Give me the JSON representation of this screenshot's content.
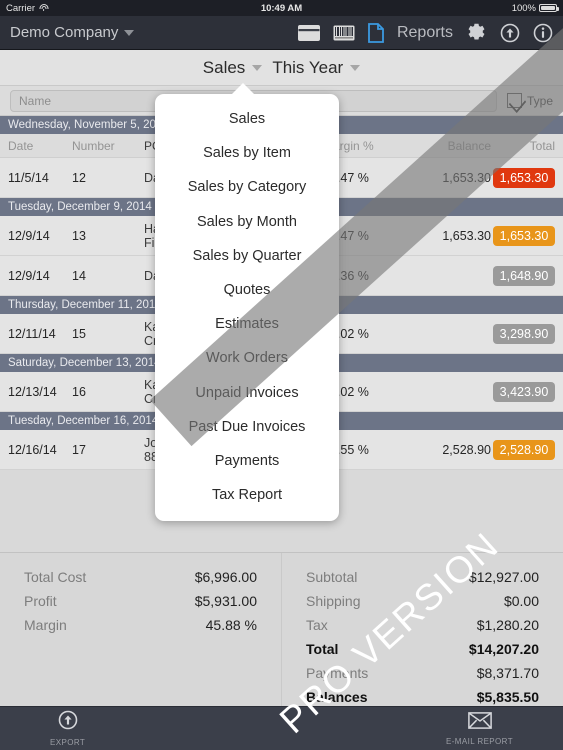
{
  "statusbar": {
    "carrier": "Carrier",
    "time": "10:49 AM",
    "battery": "100%"
  },
  "navbar": {
    "company": "Demo Company",
    "reports_label": "Reports",
    "icons": [
      "credit-card-icon",
      "barcode-icon",
      "document-icon",
      "gear-icon",
      "upload-icon",
      "info-icon"
    ]
  },
  "filterbar": {
    "report_type": "Sales",
    "period": "This Year"
  },
  "search": {
    "value": "",
    "placeholder": "Name",
    "type_label": "Type",
    "type_checked": true
  },
  "table": {
    "columns": [
      "Date",
      "Number",
      "PO",
      "Margin %",
      "Balance",
      "Total"
    ],
    "groups": [
      {
        "date_label": "Wednesday, November 5, 2014",
        "rows": [
          {
            "date": "11/5/14",
            "number": "12",
            "po": "Da",
            "margin": "33.47 %",
            "balance": "1,653.30",
            "total": "1,653.30",
            "total_color": "#e0380f"
          }
        ]
      },
      {
        "date_label": "Tuesday, December 9, 2014",
        "rows": [
          {
            "date": "12/9/14",
            "number": "13",
            "po": "Ha\nFir",
            "margin": "33.47 %",
            "balance": "1,653.30",
            "total": "1,653.30",
            "total_color": "#e8951a"
          },
          {
            "date": "12/9/14",
            "number": "14",
            "po": "Da",
            "margin": "33.36 %",
            "balance": "",
            "total": "1,648.90",
            "total_color": "#9a9a9a"
          }
        ]
      },
      {
        "date_label": "Thursday, December 11, 2014",
        "rows": [
          {
            "date": "12/11/14",
            "number": "15",
            "po": "Ka\nCr",
            "margin": "50.02 %",
            "balance": "",
            "total": "3,298.90",
            "total_color": "#9a9a9a"
          }
        ]
      },
      {
        "date_label": "Saturday, December 13, 2014",
        "rows": [
          {
            "date": "12/13/14",
            "number": "16",
            "po": "Ka\nCr",
            "margin": "52.02 %",
            "balance": "",
            "total": "3,423.90",
            "total_color": "#9a9a9a"
          }
        ]
      },
      {
        "date_label": "Tuesday, December 16, 2014",
        "rows": [
          {
            "date": "12/16/14",
            "number": "17",
            "po": "Jo\n88",
            "margin": "56.55 %",
            "balance": "2,528.90",
            "total": "2,528.90",
            "total_color": "#e8951a"
          }
        ]
      }
    ]
  },
  "popover": {
    "items": [
      "Sales",
      "Sales by Item",
      "Sales by Category",
      "Sales by Month",
      "Sales by Quarter",
      "Quotes",
      "Estimates",
      "Work Orders",
      "Unpaid Invoices",
      "Past Due Invoices",
      "Payments",
      "Tax Report"
    ]
  },
  "summary": {
    "left": [
      {
        "label": "Total Cost",
        "value": "$6,996.00",
        "bold": false
      },
      {
        "label": "Profit",
        "value": "$5,931.00",
        "bold": false
      },
      {
        "label": "Margin",
        "value": "45.88 %",
        "bold": false
      }
    ],
    "right": [
      {
        "label": "Subtotal",
        "value": "$12,927.00",
        "bold": false
      },
      {
        "label": "Shipping",
        "value": "$0.00",
        "bold": false
      },
      {
        "label": "Tax",
        "value": "$1,280.20",
        "bold": false
      },
      {
        "label": "Total",
        "value": "$14,207.20",
        "bold": true
      },
      {
        "label": "Payments",
        "value": "$8,371.70",
        "bold": false
      },
      {
        "label": "Balances",
        "value": "$5,835.50",
        "bold": true
      }
    ]
  },
  "toolbar": {
    "export_label": "EXPORT",
    "email_label": "E-MAIL REPORT"
  },
  "watermark": {
    "text": "PRO VERSION"
  },
  "colors": {
    "navbar": "#2d3039",
    "group_header": "#6c7487",
    "accent_red": "#e0380f",
    "accent_orange": "#e8951a",
    "accent_gray": "#9a9a9a",
    "doc_icon_blue": "#3b9ae1"
  }
}
